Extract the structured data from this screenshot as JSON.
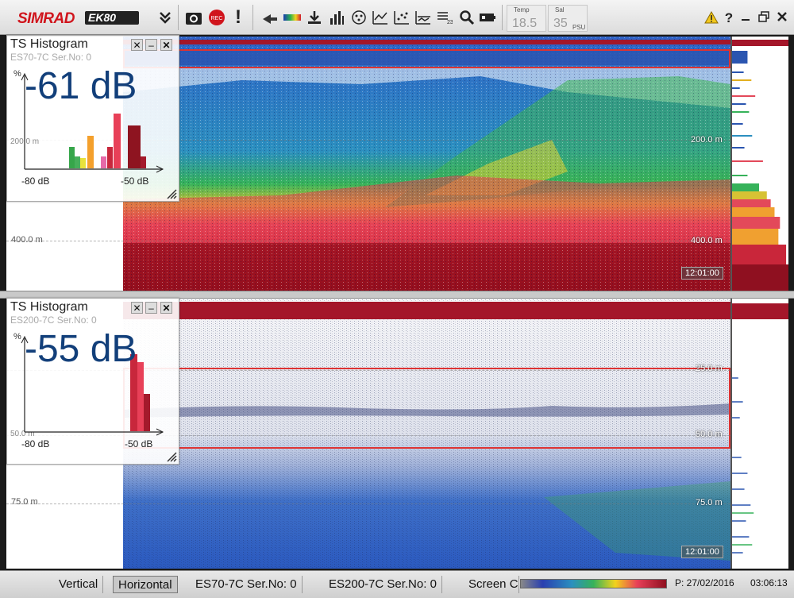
{
  "toolbar": {
    "logo": "SIMRAD",
    "logo2": "EK80",
    "temp": {
      "label": "Temp",
      "value": "18.5"
    },
    "sal": {
      "label": "Sal",
      "value": "35",
      "unit": "PSU"
    }
  },
  "panels": [
    {
      "depth_ticks": [
        "200.0 m",
        "400.0 m"
      ],
      "time": "12:01:00"
    },
    {
      "depth_ticks": [
        "25.0 m",
        "50.0 m",
        "75.0 m"
      ],
      "time": "12:01:00"
    }
  ],
  "histograms": [
    {
      "title": "TS Histogram",
      "channel": "ES70-7C Ser.No: 0",
      "value": "-61 dB",
      "y_label": "%",
      "x_min": "-80 dB",
      "x_max": "-50 dB",
      "y_tick": "200.0 m"
    },
    {
      "title": "TS Histogram",
      "channel": "ES200-7C Ser.No: 0",
      "value": "-55 dB",
      "y_label": "%",
      "x_min": "-80 dB",
      "x_max": "-50 dB",
      "y_tick": "50.0 m"
    }
  ],
  "status": {
    "tabs": [
      "Vertical",
      "Horizontal",
      "ES70-7C Ser.No: 0",
      "ES200-7C Ser.No: 0",
      "Screen C"
    ],
    "position": "P: 27/02/2016",
    "clock": "03:06:13"
  },
  "colors": {
    "brand": "#d0141c",
    "value_text": "#123f7a",
    "range_box": "#dd3333"
  }
}
